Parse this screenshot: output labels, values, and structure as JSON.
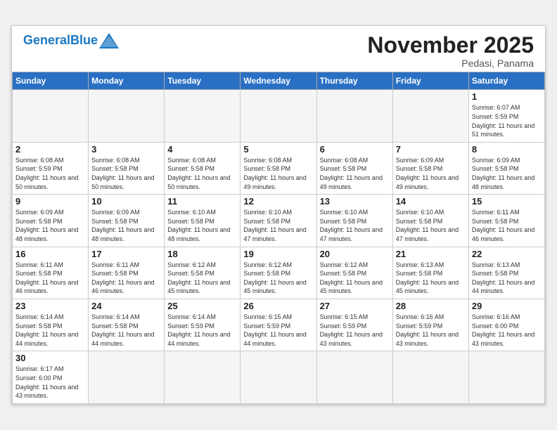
{
  "header": {
    "logo_general": "General",
    "logo_blue": "Blue",
    "month": "November 2025",
    "location": "Pedasi, Panama"
  },
  "weekdays": [
    "Sunday",
    "Monday",
    "Tuesday",
    "Wednesday",
    "Thursday",
    "Friday",
    "Saturday"
  ],
  "weeks": [
    [
      {
        "day": null
      },
      {
        "day": null
      },
      {
        "day": null
      },
      {
        "day": null
      },
      {
        "day": null
      },
      {
        "day": null
      },
      {
        "day": 1,
        "sunrise": "Sunrise: 6:07 AM",
        "sunset": "Sunset: 5:59 PM",
        "daylight": "Daylight: 11 hours and 51 minutes."
      }
    ],
    [
      {
        "day": 2,
        "sunrise": "Sunrise: 6:08 AM",
        "sunset": "Sunset: 5:59 PM",
        "daylight": "Daylight: 11 hours and 50 minutes."
      },
      {
        "day": 3,
        "sunrise": "Sunrise: 6:08 AM",
        "sunset": "Sunset: 5:58 PM",
        "daylight": "Daylight: 11 hours and 50 minutes."
      },
      {
        "day": 4,
        "sunrise": "Sunrise: 6:08 AM",
        "sunset": "Sunset: 5:58 PM",
        "daylight": "Daylight: 11 hours and 50 minutes."
      },
      {
        "day": 5,
        "sunrise": "Sunrise: 6:08 AM",
        "sunset": "Sunset: 5:58 PM",
        "daylight": "Daylight: 11 hours and 49 minutes."
      },
      {
        "day": 6,
        "sunrise": "Sunrise: 6:08 AM",
        "sunset": "Sunset: 5:58 PM",
        "daylight": "Daylight: 11 hours and 49 minutes."
      },
      {
        "day": 7,
        "sunrise": "Sunrise: 6:09 AM",
        "sunset": "Sunset: 5:58 PM",
        "daylight": "Daylight: 11 hours and 49 minutes."
      },
      {
        "day": 8,
        "sunrise": "Sunrise: 6:09 AM",
        "sunset": "Sunset: 5:58 PM",
        "daylight": "Daylight: 11 hours and 48 minutes."
      }
    ],
    [
      {
        "day": 9,
        "sunrise": "Sunrise: 6:09 AM",
        "sunset": "Sunset: 5:58 PM",
        "daylight": "Daylight: 11 hours and 48 minutes."
      },
      {
        "day": 10,
        "sunrise": "Sunrise: 6:09 AM",
        "sunset": "Sunset: 5:58 PM",
        "daylight": "Daylight: 11 hours and 48 minutes."
      },
      {
        "day": 11,
        "sunrise": "Sunrise: 6:10 AM",
        "sunset": "Sunset: 5:58 PM",
        "daylight": "Daylight: 11 hours and 48 minutes."
      },
      {
        "day": 12,
        "sunrise": "Sunrise: 6:10 AM",
        "sunset": "Sunset: 5:58 PM",
        "daylight": "Daylight: 11 hours and 47 minutes."
      },
      {
        "day": 13,
        "sunrise": "Sunrise: 6:10 AM",
        "sunset": "Sunset: 5:58 PM",
        "daylight": "Daylight: 11 hours and 47 minutes."
      },
      {
        "day": 14,
        "sunrise": "Sunrise: 6:10 AM",
        "sunset": "Sunset: 5:58 PM",
        "daylight": "Daylight: 11 hours and 47 minutes."
      },
      {
        "day": 15,
        "sunrise": "Sunrise: 6:11 AM",
        "sunset": "Sunset: 5:58 PM",
        "daylight": "Daylight: 11 hours and 46 minutes."
      }
    ],
    [
      {
        "day": 16,
        "sunrise": "Sunrise: 6:11 AM",
        "sunset": "Sunset: 5:58 PM",
        "daylight": "Daylight: 11 hours and 46 minutes."
      },
      {
        "day": 17,
        "sunrise": "Sunrise: 6:11 AM",
        "sunset": "Sunset: 5:58 PM",
        "daylight": "Daylight: 11 hours and 46 minutes."
      },
      {
        "day": 18,
        "sunrise": "Sunrise: 6:12 AM",
        "sunset": "Sunset: 5:58 PM",
        "daylight": "Daylight: 11 hours and 45 minutes."
      },
      {
        "day": 19,
        "sunrise": "Sunrise: 6:12 AM",
        "sunset": "Sunset: 5:58 PM",
        "daylight": "Daylight: 11 hours and 45 minutes."
      },
      {
        "day": 20,
        "sunrise": "Sunrise: 6:12 AM",
        "sunset": "Sunset: 5:58 PM",
        "daylight": "Daylight: 11 hours and 45 minutes."
      },
      {
        "day": 21,
        "sunrise": "Sunrise: 6:13 AM",
        "sunset": "Sunset: 5:58 PM",
        "daylight": "Daylight: 11 hours and 45 minutes."
      },
      {
        "day": 22,
        "sunrise": "Sunrise: 6:13 AM",
        "sunset": "Sunset: 5:58 PM",
        "daylight": "Daylight: 11 hours and 44 minutes."
      }
    ],
    [
      {
        "day": 23,
        "sunrise": "Sunrise: 6:14 AM",
        "sunset": "Sunset: 5:58 PM",
        "daylight": "Daylight: 11 hours and 44 minutes."
      },
      {
        "day": 24,
        "sunrise": "Sunrise: 6:14 AM",
        "sunset": "Sunset: 5:58 PM",
        "daylight": "Daylight: 11 hours and 44 minutes."
      },
      {
        "day": 25,
        "sunrise": "Sunrise: 6:14 AM",
        "sunset": "Sunset: 5:59 PM",
        "daylight": "Daylight: 11 hours and 44 minutes."
      },
      {
        "day": 26,
        "sunrise": "Sunrise: 6:15 AM",
        "sunset": "Sunset: 5:59 PM",
        "daylight": "Daylight: 11 hours and 44 minutes."
      },
      {
        "day": 27,
        "sunrise": "Sunrise: 6:15 AM",
        "sunset": "Sunset: 5:59 PM",
        "daylight": "Daylight: 11 hours and 43 minutes."
      },
      {
        "day": 28,
        "sunrise": "Sunrise: 6:16 AM",
        "sunset": "Sunset: 5:59 PM",
        "daylight": "Daylight: 11 hours and 43 minutes."
      },
      {
        "day": 29,
        "sunrise": "Sunrise: 6:16 AM",
        "sunset": "Sunset: 6:00 PM",
        "daylight": "Daylight: 11 hours and 43 minutes."
      }
    ],
    [
      {
        "day": 30,
        "sunrise": "Sunrise: 6:17 AM",
        "sunset": "Sunset: 6:00 PM",
        "daylight": "Daylight: 11 hours and 43 minutes."
      },
      {
        "day": null
      },
      {
        "day": null
      },
      {
        "day": null
      },
      {
        "day": null
      },
      {
        "day": null
      },
      {
        "day": null
      }
    ]
  ]
}
